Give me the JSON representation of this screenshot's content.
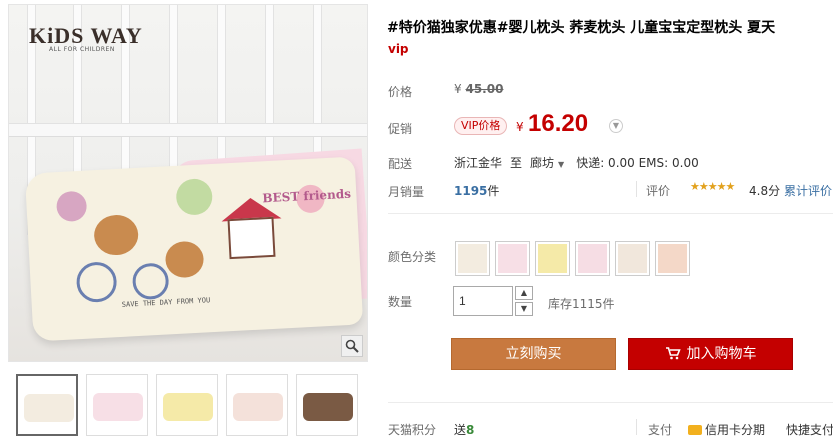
{
  "product": {
    "title": "#特价猫独家优惠#婴儿枕头 荞麦枕头 儿童宝宝定型枕头 夏天",
    "vip_tag": "vip"
  },
  "gallery": {
    "logo_text": "KiDS WAY",
    "logo_sub": "ALL FOR CHILDREN",
    "zoom_icon": "magnifier-icon",
    "pillow_text": "BEST friends",
    "pillow_scribble": "SAVE THE DAY FROM YOU",
    "thumb_colors": [
      "#f3ece0",
      "#f7dfe6",
      "#f5eaa8",
      "#f4e1da",
      "#7a5a44"
    ]
  },
  "price": {
    "label": "价格",
    "currency": "¥",
    "original": "45.00"
  },
  "promo": {
    "label": "促销",
    "badge": "VIP价格",
    "currency": "¥",
    "price": "16.20"
  },
  "shipping": {
    "label": "配送",
    "from": "浙江金华",
    "to_word": "至",
    "to": "廊坊",
    "fees": "快递: 0.00 EMS: 0.00"
  },
  "sales": {
    "label": "月销量",
    "count": "1195",
    "unit": "件",
    "rating_label": "评价",
    "stars": "★★★★★",
    "score": "4.8分",
    "rating_link": "累计评价"
  },
  "color_option": {
    "label": "颜色分类",
    "swatch_colors": [
      "#f3ece0",
      "#f7dfe6",
      "#f5eaa8",
      "#f6dde4",
      "#f1e7dc",
      "#f4d8c8"
    ]
  },
  "quantity": {
    "label": "数量",
    "value": "1",
    "stock": "库存1115件"
  },
  "actions": {
    "buy_now": "立刻购买",
    "add_to_cart": "加入购物车"
  },
  "footer": {
    "points_label": "天猫积分",
    "points_prefix": "送",
    "points_value": "8",
    "pay_label": "支付",
    "pay_credit": "信用卡分期",
    "pay_quick": "快捷支付"
  },
  "colors": {
    "accent_red": "#c40000",
    "buy_orange": "#c8793f",
    "link_blue": "#3a6fa3"
  }
}
